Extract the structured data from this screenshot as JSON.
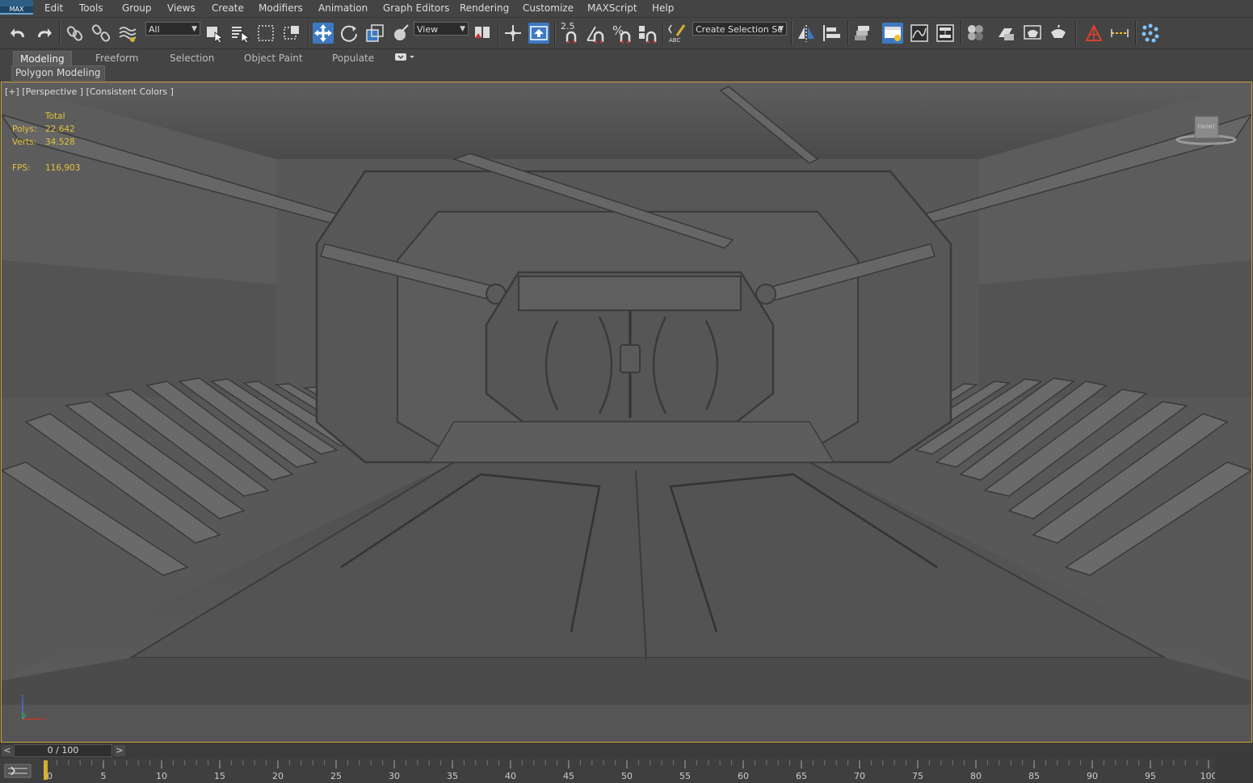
{
  "app": {
    "logo_text": "MAX"
  },
  "menu": [
    "Edit",
    "Tools",
    "Group",
    "Views",
    "Create",
    "Modifiers",
    "Animation",
    "Graph Editors",
    "Rendering",
    "Customize",
    "MAXScript",
    "Help"
  ],
  "toolbar": {
    "selection_filter": "All",
    "ref_coord_system": "View",
    "snap_2_5_label": "2.5",
    "named_selection_placeholder": "Create Selection Se",
    "icons": [
      "undo-icon",
      "redo-icon",
      "link-icon",
      "unlink-icon",
      "bind-space-warp-icon",
      "select-object-icon",
      "select-by-name-icon",
      "rect-region-icon",
      "window-crossing-icon",
      "select-move-icon",
      "select-rotate-icon",
      "select-scale-icon",
      "placement-icon",
      "pivot-icon",
      "manipulate-icon",
      "keyboard-shortcut-icon",
      "snaps-toggle-icon",
      "angle-snap-icon",
      "percent-snap-icon",
      "spinner-snap-icon",
      "edit-named-selection-icon",
      "mirror-icon",
      "align-icon",
      "scene-explorer-icon",
      "layer-explorer-icon",
      "toggle-ribbon-icon",
      "curve-editor-icon",
      "schematic-view-icon",
      "material-editor-icon",
      "render-setup-icon",
      "rendered-frame-icon",
      "render-production-icon",
      "render-cloud-icon",
      "civil-view-icon",
      "measure-icon",
      "particle-view-icon"
    ]
  },
  "ribbon": {
    "tabs": [
      "Modeling",
      "Freeform",
      "Selection",
      "Object Paint",
      "Populate"
    ],
    "active_tab": "Modeling",
    "panel_label": "Polygon Modeling"
  },
  "viewport": {
    "label": "[+] [Perspective ] [Consistent Colors ]",
    "stats": {
      "total_label": "Total",
      "polys_label": "Polys:",
      "polys_value": "22.642",
      "verts_label": "Verts:",
      "verts_value": "34.528",
      "fps_label": "FPS:",
      "fps_value": "116,903"
    },
    "viewcube_label": "FRONT",
    "axis_labels": {
      "z": "z",
      "y": "y",
      "x": "x"
    }
  },
  "timeline": {
    "prev_label": "<",
    "next_label": ">",
    "slider_text": "0 / 100",
    "current_frame": 0,
    "ticks": [
      "0",
      "5",
      "10",
      "15",
      "20",
      "25",
      "30",
      "35",
      "40",
      "45",
      "50",
      "55",
      "60",
      "65",
      "70",
      "75",
      "80",
      "85",
      "90",
      "95",
      "100"
    ]
  },
  "colors": {
    "ui_bg": "#444444",
    "active_blue": "#3c79c2",
    "viewport_border": "#c8a13a",
    "stats_yellow": "#e2c23a"
  }
}
